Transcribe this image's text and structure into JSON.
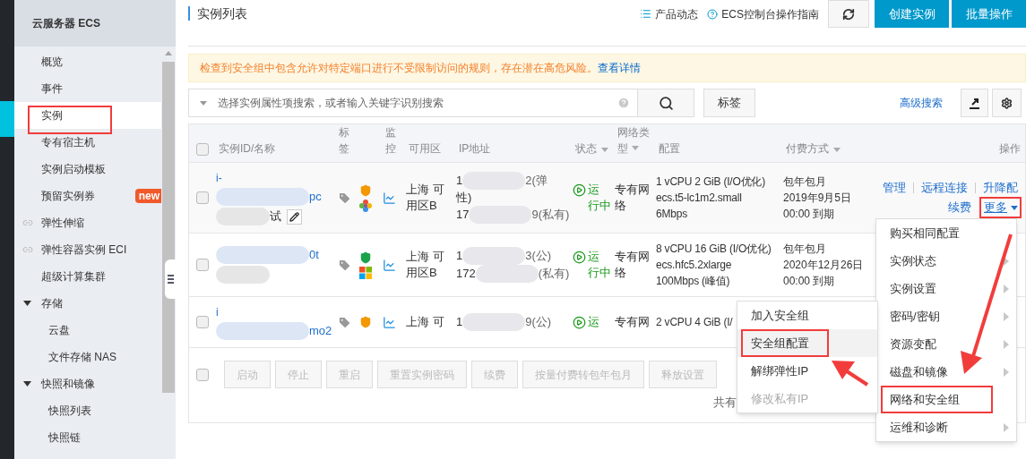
{
  "sidebar": {
    "title": "云服务器 ECS",
    "items": [
      {
        "label": "概览",
        "selected": false,
        "external": false,
        "annotated": false
      },
      {
        "label": "事件",
        "selected": false,
        "external": false,
        "annotated": false
      },
      {
        "label": "实例",
        "selected": true,
        "external": false,
        "annotated": true
      },
      {
        "label": "专有宿主机",
        "selected": false,
        "external": false,
        "annotated": false
      },
      {
        "label": "实例启动模板",
        "selected": false,
        "external": false,
        "annotated": false
      },
      {
        "label": "预留实例券",
        "selected": false,
        "external": false,
        "annotated": false,
        "badge": "new"
      },
      {
        "label": "弹性伸缩",
        "selected": false,
        "external": true,
        "annotated": false
      },
      {
        "label": "弹性容器实例 ECI",
        "selected": false,
        "external": true,
        "annotated": false
      },
      {
        "label": "超级计算集群",
        "selected": false,
        "external": false,
        "annotated": false
      },
      {
        "label": "存储",
        "kind": "group",
        "selected": false,
        "external": false,
        "annotated": false,
        "expanded": true,
        "children": [
          {
            "label": "云盘",
            "selected": false
          },
          {
            "label": "文件存储 NAS",
            "selected": false
          }
        ]
      },
      {
        "label": "快照和镜像",
        "kind": "group",
        "selected": false,
        "external": false,
        "annotated": false,
        "expanded": true,
        "children": [
          {
            "label": "快照列表",
            "selected": false
          },
          {
            "label": "快照链",
            "selected": false
          }
        ]
      }
    ]
  },
  "header": {
    "title": "实例列表",
    "links": [
      {
        "kind": "list",
        "label": "产品动态"
      },
      {
        "kind": "help",
        "label": "ECS控制台操作指南"
      }
    ],
    "buttons": [
      {
        "kind": "refresh"
      },
      {
        "kind": "primary",
        "label": "创建实例"
      },
      {
        "kind": "primary",
        "label": "批量操作"
      }
    ]
  },
  "alert": {
    "text": "检查到安全组中包含允许对特定端口进行不受限制访问的规则，存在潜在高危风险。",
    "link": "查看详情"
  },
  "search": {
    "placeholder": "选择实例属性项搜索，或者输入关键字识别搜索",
    "tag_button": "标签",
    "advanced_link": "高级搜索"
  },
  "table": {
    "header_checked": false,
    "columns": [
      {
        "label": "实例ID/名称",
        "sortable": false,
        "kind": "text"
      },
      {
        "label": "标签",
        "sortable": false,
        "kind": "vertical"
      },
      {
        "label": "监控",
        "sortable": false,
        "kind": "vertical"
      },
      {
        "label": "可用区",
        "sortable": false,
        "kind": "text"
      },
      {
        "label": "IP地址",
        "sortable": false,
        "kind": "text"
      },
      {
        "label": "状态",
        "sortable": true,
        "kind": "text"
      },
      {
        "label": "网络类型",
        "sortable": true,
        "kind": "narrow"
      },
      {
        "label": "配置",
        "sortable": false,
        "kind": "text"
      },
      {
        "label": "付费方式",
        "sortable": true,
        "kind": "text"
      },
      {
        "label": "操作",
        "sortable": false,
        "kind": "right"
      }
    ],
    "rows": [
      {
        "selected": false,
        "name_lines": [
          {
            "head": "i-",
            "redacted": false,
            "link": true,
            "editable": false
          },
          {
            "redacted": true,
            "tail": "pc",
            "link": true,
            "editable": false
          },
          {
            "redacted": true,
            "tail": "试",
            "link": false,
            "editable": true
          }
        ],
        "security_risk": true,
        "windows": false,
        "zone": [
          "上海 可",
          "用区B"
        ],
        "ip": [
          {
            "head": "1",
            "redacted": true,
            "tail": "2(弹"
          },
          {
            "head": "性)",
            "redacted": false
          },
          {
            "head": "17",
            "redacted": true,
            "tail": "9(私有)"
          }
        ],
        "status": {
          "kind": "running",
          "lines": [
            "运",
            "行中"
          ]
        },
        "network": [
          "专有网",
          "络"
        ],
        "config": [
          "1 vCPU 2 GiB (I/O优化)",
          "ecs.t5-lc1m2.small",
          "6Mbps"
        ],
        "billing": [
          "包年包月",
          "2019年9月5日",
          "00:00 到期"
        ],
        "actions": [
          [
            {
              "label": "管理",
              "dropdown": false,
              "annotated": false
            },
            {
              "label": "远程连接",
              "dropdown": false,
              "annotated": false
            },
            {
              "label": "升降配",
              "dropdown": false,
              "annotated": false
            }
          ],
          [
            {
              "label": "续费",
              "dropdown": false,
              "annotated": false
            },
            {
              "label": "更多",
              "dropdown": true,
              "annotated": true
            }
          ]
        ]
      },
      {
        "selected": false,
        "name_lines": [
          {
            "redacted": true,
            "tail": "0t",
            "link": true,
            "editable": false
          },
          {
            "redacted": true,
            "link": false,
            "editable": false
          }
        ],
        "security_risk": false,
        "windows": true,
        "zone": [
          "上海 可",
          "用区B"
        ],
        "ip": [
          {
            "head": "1",
            "redacted": true,
            "tail": "3(公)"
          },
          {
            "head": "172",
            "redacted": true,
            "tail": "(私有)"
          }
        ],
        "status": {
          "kind": "running",
          "lines": [
            "运",
            "行中"
          ]
        },
        "network": [
          "专有网",
          "络"
        ],
        "config": [
          "8 vCPU 16 GiB (I/O优化)",
          "ecs.hfc5.2xlarge",
          "100Mbps (峰值)"
        ],
        "billing": [
          "包年包月",
          "2020年12月26日",
          "00:00 到期"
        ]
      },
      {
        "selected": false,
        "name_lines": [
          {
            "head": "i",
            "redacted": false,
            "link": true,
            "editable": false
          },
          {
            "redacted": true,
            "tail": "mo2",
            "link": true,
            "editable": false
          }
        ],
        "security_risk": true,
        "zone": [
          "上海 可"
        ],
        "ip": [
          {
            "head": "1",
            "redacted": true,
            "tail": "9(公)"
          }
        ],
        "status": {
          "kind": "running",
          "lines": [
            "运"
          ]
        },
        "network": [
          "专有网"
        ],
        "config": [
          "2 vCPU 4 GiB (I/"
        ]
      }
    ],
    "bulk": {
      "checked": false,
      "buttons": [
        {
          "label": "启动",
          "disabled": true
        },
        {
          "label": "停止",
          "disabled": true
        },
        {
          "label": "重启",
          "disabled": true
        },
        {
          "label": "重置实例密码",
          "disabled": true
        },
        {
          "label": "续费",
          "disabled": true
        },
        {
          "label": "按量付费转包年包月",
          "disabled": true
        },
        {
          "label": "释放设置",
          "disabled": true
        }
      ],
      "total": "共有"
    }
  },
  "menu": {
    "items": [
      {
        "label": "购买相同配置",
        "submenu": false,
        "annotated": false
      },
      {
        "label": "实例状态",
        "submenu": true,
        "annotated": false
      },
      {
        "label": "实例设置",
        "submenu": true,
        "annotated": false
      },
      {
        "label": "密码/密钥",
        "submenu": true,
        "annotated": false
      },
      {
        "label": "资源变配",
        "submenu": true,
        "annotated": false
      },
      {
        "label": "磁盘和镜像",
        "submenu": true,
        "annotated": false
      },
      {
        "label": "网络和安全组",
        "submenu": false,
        "annotated": true
      },
      {
        "label": "运维和诊断",
        "submenu": true,
        "annotated": false
      }
    ]
  },
  "submenu": {
    "items": [
      {
        "label": "加入安全组",
        "selected": false,
        "disabled": false,
        "annotated": false
      },
      {
        "label": "安全组配置",
        "selected": true,
        "disabled": false,
        "annotated": true
      },
      {
        "label": "解绑弹性IP",
        "selected": false,
        "disabled": false,
        "annotated": false
      },
      {
        "label": "修改私有IP",
        "selected": false,
        "disabled": true,
        "annotated": false
      }
    ]
  }
}
